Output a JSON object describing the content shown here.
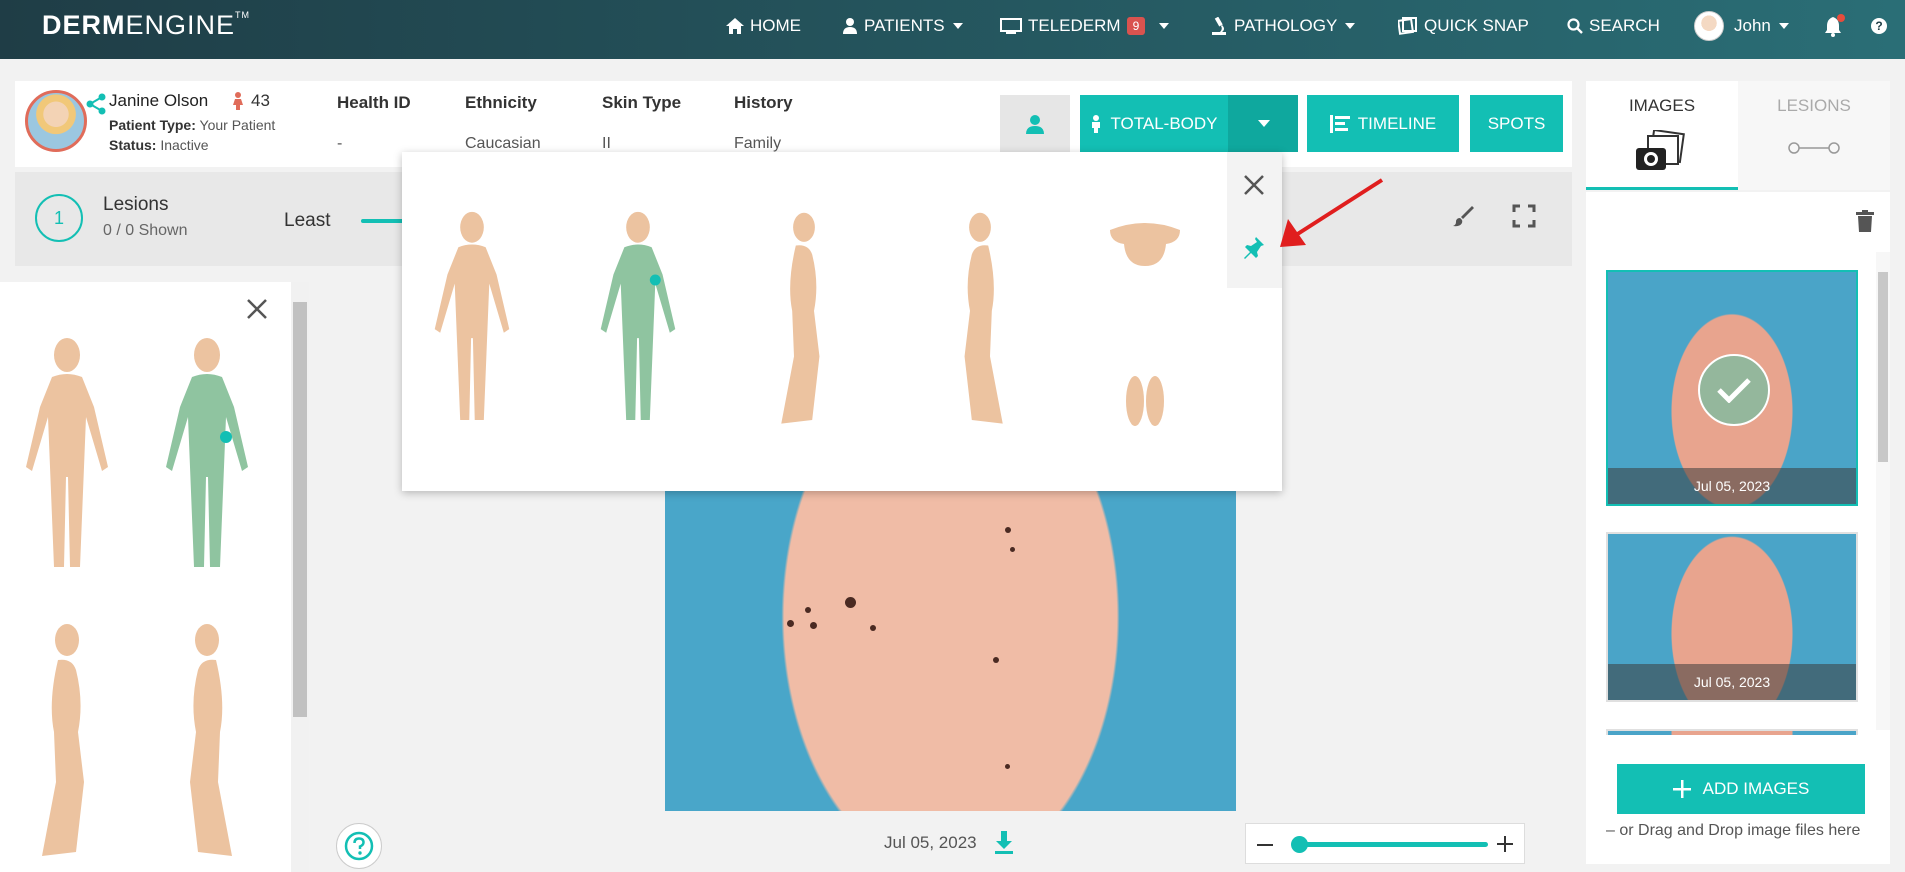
{
  "brand": {
    "bold": "DERM",
    "thin": "ENGINE",
    "tm": "TM"
  },
  "nav": {
    "home": "HOME",
    "patients": "PATIENTS",
    "telederm": "TELEDERM",
    "telederm_badge": "9",
    "pathology": "PATHOLOGY",
    "quick_snap": "QUICK SNAP",
    "search": "SEARCH",
    "user": "John",
    "help": "?"
  },
  "patient": {
    "name": "Janine Olson",
    "age": "43",
    "type_label": "Patient Type:",
    "type_value": "Your Patient",
    "status_label": "Status:",
    "status_value": "Inactive",
    "columns": [
      {
        "head": "Health ID",
        "value": "-"
      },
      {
        "head": "Ethnicity",
        "value": "Caucasian"
      },
      {
        "head": "Skin Type",
        "value": "II"
      },
      {
        "head": "History",
        "value": "Family"
      }
    ]
  },
  "actions": {
    "total_body": "TOTAL-BODY",
    "timeline": "TIMELINE",
    "spots": "SPOTS"
  },
  "right_tabs": {
    "images": "IMAGES",
    "lesions": "LESIONS"
  },
  "lesions_bar": {
    "count": "1",
    "title": "Lesions",
    "shown": "0 / 0 Shown",
    "least": "Least"
  },
  "main_image": {
    "date": "Jul 05, 2023"
  },
  "thumbnails": [
    {
      "date": "Jul 05, 2023",
      "selected": true
    },
    {
      "date": "Jul 05, 2023",
      "selected": false
    }
  ],
  "add_images": "ADD IMAGES",
  "drop_hint": "– or Drag and Drop image files here",
  "colors": {
    "teal": "#13bfb4",
    "navbar": "#1f3d46",
    "alert": "#d9534f"
  }
}
